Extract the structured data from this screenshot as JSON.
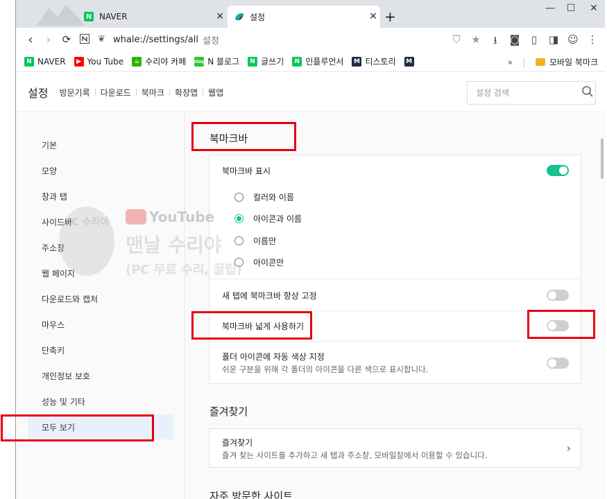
{
  "tabs": [
    {
      "label": "NAVER",
      "icon": "naver-icon"
    },
    {
      "label": "설정",
      "icon": "whale-icon"
    }
  ],
  "window_controls": {
    "minimize": "—",
    "maximize": "☐",
    "close": "✕"
  },
  "address": {
    "url": "whale://settings/all",
    "page_label": "설정"
  },
  "bookmarks": [
    {
      "label": "NAVER",
      "icon": "N"
    },
    {
      "label": "You Tube",
      "icon": "▶"
    },
    {
      "label": "수리야 카페",
      "icon": "☕"
    },
    {
      "label": "N 블로그",
      "icon": "blog"
    },
    {
      "label": "글쓰기",
      "icon": "N"
    },
    {
      "label": "인플루언서",
      "icon": "N"
    },
    {
      "label": "티스토리",
      "icon": "M"
    },
    {
      "label": "",
      "icon": "M"
    }
  ],
  "bookmarks_more": "»",
  "mobile_bookmarks": "모바일 북마크",
  "settings_header": {
    "title": "설정",
    "links": [
      "방문기록",
      "다운로드",
      "북마크",
      "확장앱",
      "웹앱"
    ],
    "search_placeholder": "설정 검색"
  },
  "sidebar": {
    "items": [
      "기본",
      "모양",
      "창과 탭",
      "사이드바",
      "주소창",
      "웹 페이지",
      "다운로드와 캡처",
      "마우스",
      "단축키",
      "개인정보 보호",
      "성능 및 기타",
      "모두 보기"
    ],
    "active": "모두 보기"
  },
  "bookmark_bar_section": {
    "title": "북마크바",
    "show_label": "북마크바 표시",
    "show_enabled": true,
    "options": [
      "컬러와 이름",
      "아이콘과 이름",
      "이름만",
      "아이콘만"
    ],
    "selected_option": "아이콘과 이름",
    "pin_new_tab_label": "새 탭에 북마크바 항상 고정",
    "pin_new_tab_enabled": false,
    "wide_label": "북마크바 넓게 사용하기",
    "wide_enabled": false,
    "folder_color_label": "폴더 아이콘에 자동 색상 지정",
    "folder_color_desc": "쉬운 구분을 위해 각 폴더의 아이콘을 다른 색으로 표시합니다.",
    "folder_color_enabled": false
  },
  "favorites_section": {
    "title": "즐겨찾기",
    "item_label": "즐겨찾기",
    "item_desc": "즐겨 찾는 사이트를 추가하고 새 탭과 주소창, 모바일창에서 이용할 수 있습니다."
  },
  "frequent_section": {
    "title": "자주 방문한 사이트"
  },
  "watermark": {
    "badge": "PC 수리야",
    "channel": "YouTube",
    "name": "맨날 수리야",
    "sub": "(PC 무료 수리, 꿀팁)"
  },
  "colors": {
    "accent": "#14c38e",
    "annotation": "#e60012",
    "sidebar_active": "#e8f1fb"
  }
}
